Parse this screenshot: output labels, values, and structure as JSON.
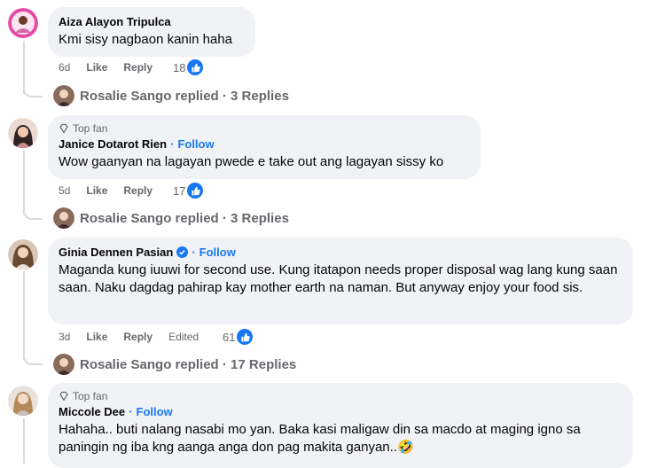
{
  "comments": [
    {
      "name": "Aiza Alayon Tripulca",
      "top_fan": "",
      "follow": "",
      "text": "Kmi sisy nagbaon kanin haha",
      "time": "6d",
      "like": "Like",
      "reply": "Reply",
      "edited": "",
      "reactions": "18",
      "replied_by": "Rosalie Sango replied · 3 Replies"
    },
    {
      "name": "Janice Dotarot Rien",
      "top_fan": "Top fan",
      "follow": "Follow",
      "text": "Wow gaanyan na lagayan pwede e take out ang lagayan sissy ko",
      "time": "5d",
      "like": "Like",
      "reply": "Reply",
      "edited": "",
      "reactions": "17",
      "replied_by": "Rosalie Sango replied · 3 Replies"
    },
    {
      "name": "Ginia Dennen Pasian",
      "top_fan": "",
      "follow": "Follow",
      "text": "Maganda kung iuuwi for second use. Kung itatapon needs proper disposal wag lang kung saan saan. Naku dagdag pahirap kay mother earth na naman. But anyway enjoy your food sis.",
      "time": "3d",
      "like": "Like",
      "reply": "Reply",
      "edited": "Edited",
      "reactions": "61",
      "replied_by": "Rosalie Sango replied · 17 Replies"
    },
    {
      "name": "Miccole Dee",
      "top_fan": "Top fan",
      "follow": "Follow",
      "text": "Hahaha.. buti nalang nasabi mo yan. Baka kasi maligaw din sa macdo at maging igno sa paningin ng iba kng aanga anga don pag makita ganyan..",
      "emoji": "🤣"
    }
  ],
  "separator": "·",
  "colors": {
    "link_blue": "#1877f2",
    "bubble_bg": "#f0f2f5",
    "meta_gray": "#65676b"
  },
  "icons": {
    "like_badge": "thumbs-up-icon",
    "top_fan": "diamond-icon",
    "verified": "verified-badge-icon"
  }
}
